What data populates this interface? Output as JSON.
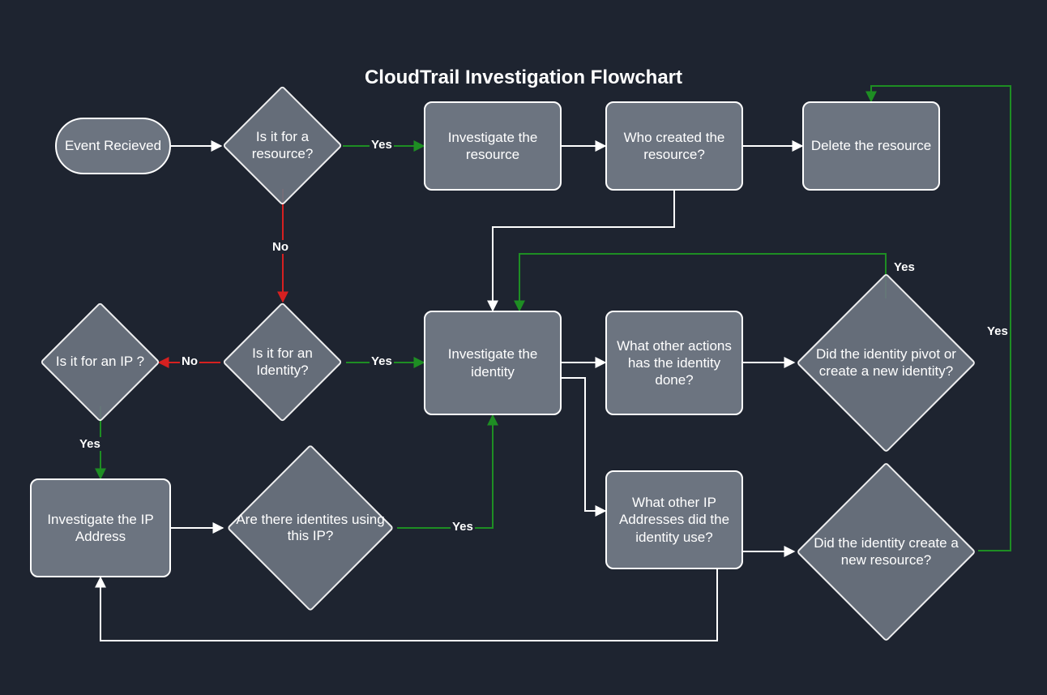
{
  "title": "CloudTrail Investigation Flowchart",
  "nodes": {
    "event_received": "Event Recieved",
    "is_resource": "Is it for a resource?",
    "investigate_resource": "Investigate the resource",
    "who_created": "Who created the resource?",
    "delete_resource": "Delete the resource",
    "is_identity": "Is it for an Identity?",
    "is_ip": "Is it for an IP ?",
    "investigate_identity": "Investigate the identity",
    "other_actions": "What other actions has the identity done?",
    "pivot_identity": "Did the identity pivot or create a new identity?",
    "investigate_ip": "Investigate the IP Address",
    "identities_using_ip": "Are there identites using this IP?",
    "other_ips": "What other IP Addresses did the identity use?",
    "create_new_resource": "Did the identity create a new resource?"
  },
  "labels": {
    "yes": "Yes",
    "no": "No"
  },
  "colors": {
    "bg": "#1e2430",
    "node_fill": "#6c7480",
    "stroke": "#ffffff",
    "yes": "#1e8e23",
    "no": "#d62020"
  }
}
